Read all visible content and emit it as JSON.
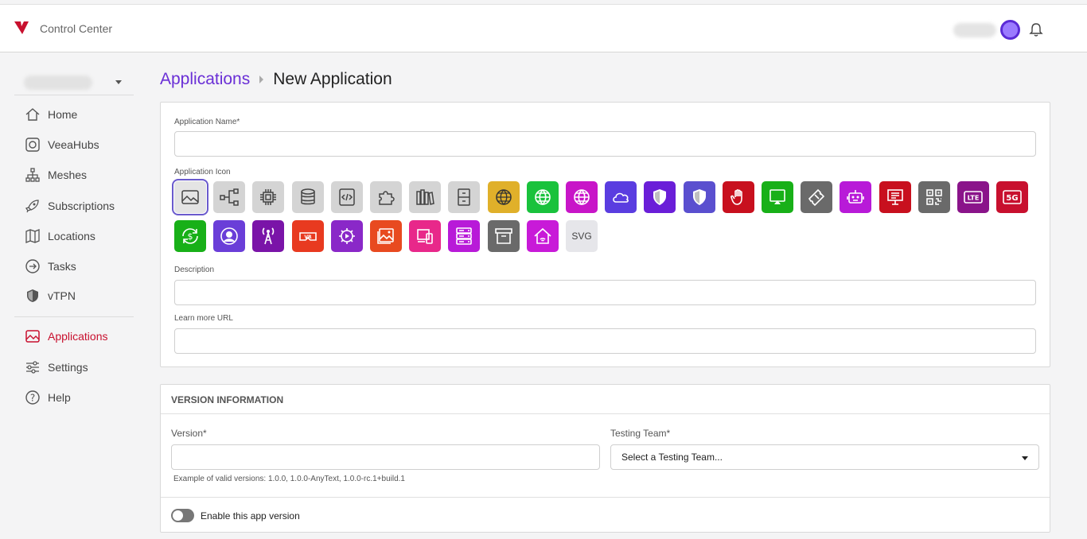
{
  "header": {
    "brand": "Control Center"
  },
  "sidebar": {
    "items": [
      {
        "label": "Home",
        "icon": "home-icon"
      },
      {
        "label": "VeeaHubs",
        "icon": "hub-icon"
      },
      {
        "label": "Meshes",
        "icon": "mesh-icon"
      },
      {
        "label": "Subscriptions",
        "icon": "rocket-icon"
      },
      {
        "label": "Locations",
        "icon": "map-icon"
      },
      {
        "label": "Tasks",
        "icon": "tasks-icon"
      },
      {
        "label": "vTPN",
        "icon": "shield-icon"
      },
      {
        "label": "Applications",
        "icon": "applications-icon",
        "active": true
      },
      {
        "label": "Settings",
        "icon": "sliders-icon"
      },
      {
        "label": "Help",
        "icon": "help-icon"
      }
    ]
  },
  "breadcrumb": {
    "parent": "Applications",
    "current": "New Application"
  },
  "form": {
    "name_label": "Application Name*",
    "icon_label": "Application Icon",
    "description_label": "Description",
    "url_label": "Learn more URL",
    "svg_label": "SVG",
    "icons": [
      {
        "name": "image-icon",
        "bg": "#e4e4e4"
      },
      {
        "name": "network-icon",
        "bg": "#d4d4d4"
      },
      {
        "name": "chip-icon",
        "bg": "#d4d4d4"
      },
      {
        "name": "database-icon",
        "bg": "#d4d4d4"
      },
      {
        "name": "code-icon",
        "bg": "#d4d4d4"
      },
      {
        "name": "puzzle-icon",
        "bg": "#d4d4d4"
      },
      {
        "name": "library-icon",
        "bg": "#d4d4d4"
      },
      {
        "name": "cabinet-icon",
        "bg": "#d4d4d4"
      },
      {
        "name": "globe-gold-icon",
        "bg": "#e0b02a"
      },
      {
        "name": "globe-green-icon",
        "bg": "#19c23c"
      },
      {
        "name": "globe-pink-icon",
        "bg": "#c815c8"
      },
      {
        "name": "cloud-icon",
        "bg": "#5a3de0"
      },
      {
        "name": "shield-icon",
        "bg": "#6a1ed8"
      },
      {
        "name": "shield-icon",
        "bg": "#5a4fcf"
      },
      {
        "name": "hand-icon",
        "bg": "#c8101e"
      },
      {
        "name": "screen-cast-icon",
        "bg": "#18b018"
      },
      {
        "name": "ticket-icon",
        "bg": "#6a6a6a"
      },
      {
        "name": "robot-icon",
        "bg": "#b81ad8"
      },
      {
        "name": "presentation-icon",
        "bg": "#c8101e"
      },
      {
        "name": "qr-code-icon",
        "bg": "#6a6a6a"
      },
      {
        "name": "lte-icon",
        "bg": "#8a148a"
      },
      {
        "name": "5g-icon",
        "bg": "#c8102e"
      },
      {
        "name": "dollar-refresh-icon",
        "bg": "#18b018"
      },
      {
        "name": "user-circle-icon",
        "bg": "#6a3ed8"
      },
      {
        "name": "tower-icon",
        "bg": "#7a14a8"
      },
      {
        "name": "vr-headset-icon",
        "bg": "#e83a20"
      },
      {
        "name": "gear-play-icon",
        "bg": "#8a28c8"
      },
      {
        "name": "photo-icon",
        "bg": "#e84a20"
      },
      {
        "name": "devices-icon",
        "bg": "#e8288a"
      },
      {
        "name": "server-icon",
        "bg": "#b81ad8"
      },
      {
        "name": "archive-icon",
        "bg": "#6a6a6a"
      },
      {
        "name": "smart-home-icon",
        "bg": "#c81ad8"
      },
      {
        "name": "svg-upload",
        "bg": "#e6e6ea"
      }
    ]
  },
  "version": {
    "title": "VERSION INFORMATION",
    "version_label": "Version*",
    "team_label": "Testing Team*",
    "team_select": "Select a Testing Team...",
    "hint": "Example of valid versions: 1.0.0, 1.0.0-AnyText, 1.0.0-rc.1+build.1",
    "toggle_label": "Enable this app version"
  }
}
